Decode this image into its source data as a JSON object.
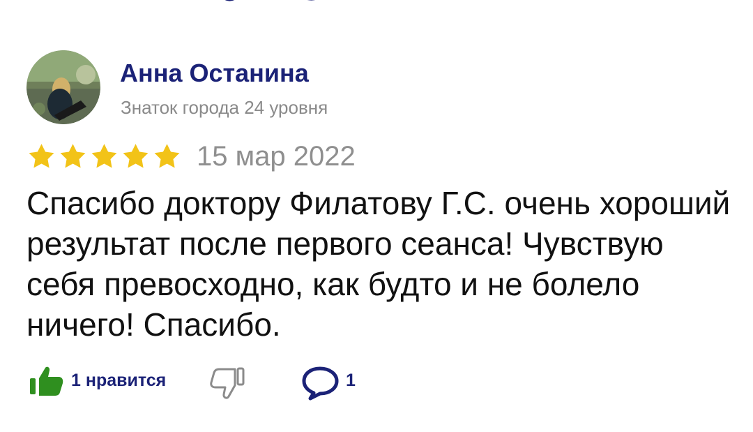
{
  "review": {
    "author_name": "Анна Останина",
    "author_level": "Знаток города 24 уровня",
    "rating": 5,
    "date": "15 мар 2022",
    "text": "Спасибо доктору Филатову Г.С. очень хороший результат после первого сеанса! Чувствую себя превосходно, как будто и не болело ничего! Спасибо."
  },
  "actions": {
    "like_label": "1 нравится",
    "comment_count": "1"
  },
  "colors": {
    "accent": "#1b2277",
    "like_green": "#2f8f1f",
    "star": "#f2c318",
    "meta_gray": "#8a8a8a"
  },
  "icons": {
    "like": "thumbs-up-icon",
    "dislike": "thumbs-down-icon",
    "comment": "comment-bubble-icon"
  }
}
